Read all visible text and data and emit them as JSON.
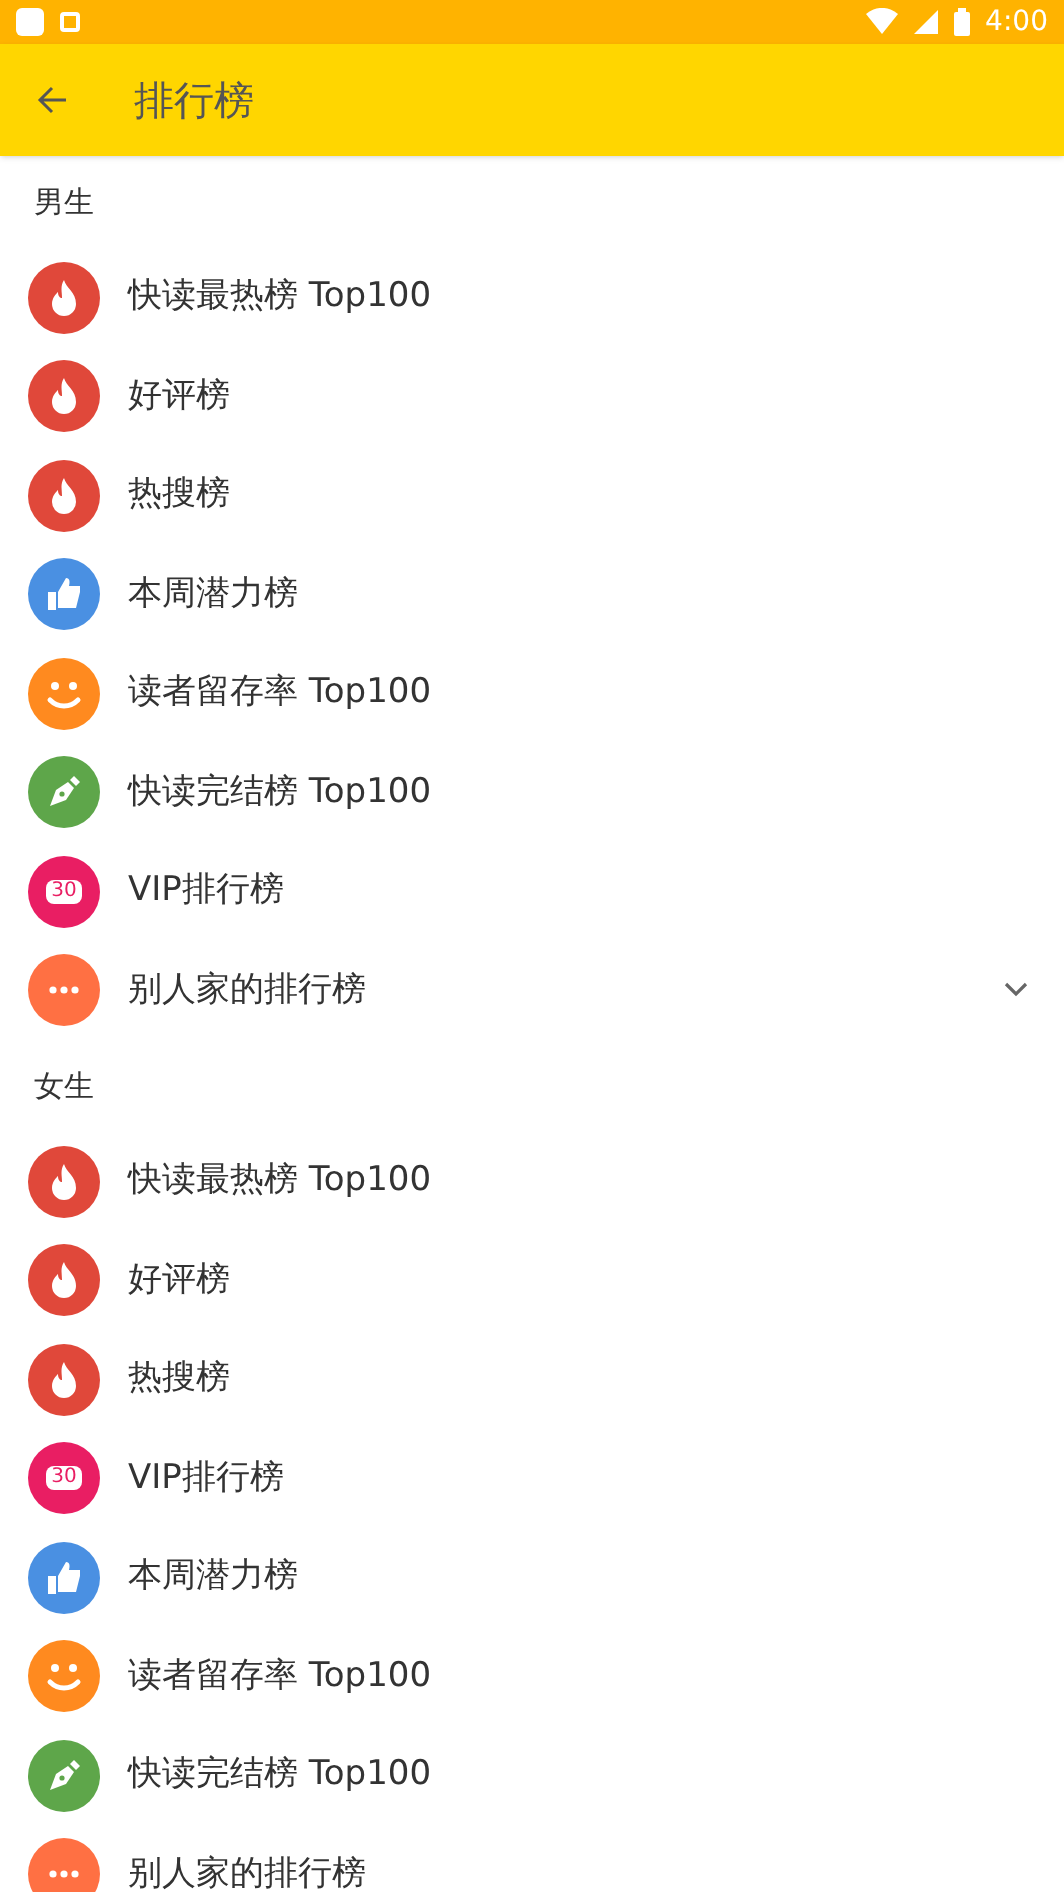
{
  "status_bar": {
    "time": "4:00"
  },
  "app_bar": {
    "title": "排行榜"
  },
  "sections": [
    {
      "title": "男生",
      "items": [
        {
          "label": "快读最热榜 Top100",
          "kind": "flame",
          "color": "#e0483a"
        },
        {
          "label": "好评榜",
          "kind": "flame",
          "color": "#e0483a"
        },
        {
          "label": "热搜榜",
          "kind": "flame",
          "color": "#e0483a"
        },
        {
          "label": "本周潜力榜",
          "kind": "thumb",
          "color": "#4a90e2"
        },
        {
          "label": "读者留存率 Top100",
          "kind": "smile",
          "color": "#ff8a1f"
        },
        {
          "label": "快读完结榜 Top100",
          "kind": "pen",
          "color": "#5ea64a"
        },
        {
          "label": "VIP排行榜",
          "kind": "ticket",
          "color": "#e91e63",
          "ticket_text": "30"
        },
        {
          "label": "别人家的排行榜",
          "kind": "group",
          "color": "#ff7043",
          "expanded": false
        }
      ]
    },
    {
      "title": "女生",
      "items": [
        {
          "label": "快读最热榜 Top100",
          "kind": "flame",
          "color": "#e0483a"
        },
        {
          "label": "好评榜",
          "kind": "flame",
          "color": "#e0483a"
        },
        {
          "label": "热搜榜",
          "kind": "flame",
          "color": "#e0483a"
        },
        {
          "label": "VIP排行榜",
          "kind": "ticket",
          "color": "#e91e63",
          "ticket_text": "30"
        },
        {
          "label": "本周潜力榜",
          "kind": "thumb",
          "color": "#4a90e2"
        },
        {
          "label": "读者留存率 Top100",
          "kind": "smile",
          "color": "#ff8a1f"
        },
        {
          "label": "快读完结榜 Top100",
          "kind": "pen",
          "color": "#5ea64a"
        },
        {
          "label": "别人家的排行榜",
          "kind": "dots",
          "color": "#ff7043"
        }
      ]
    }
  ]
}
